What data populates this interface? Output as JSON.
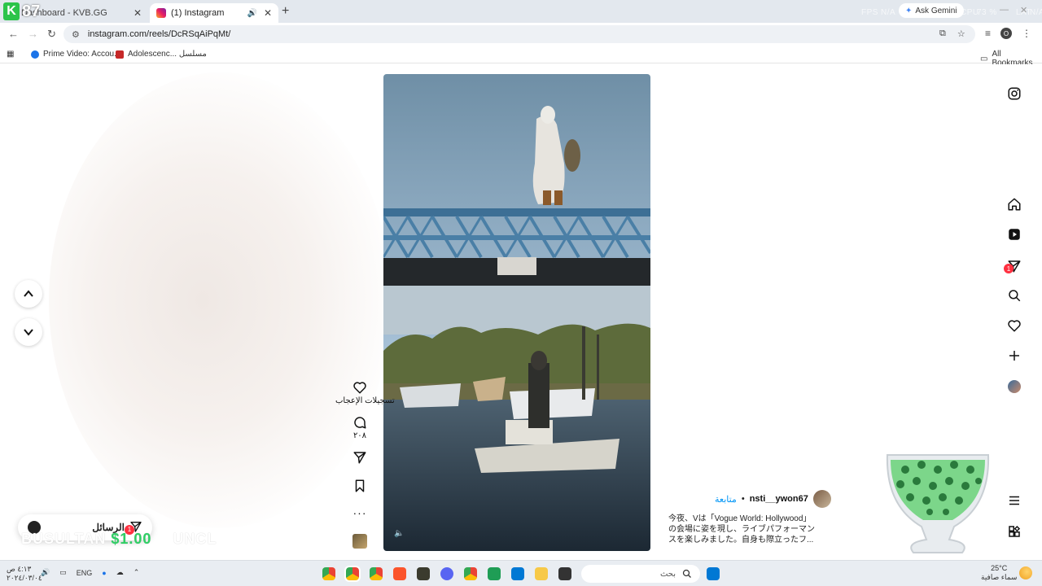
{
  "kvb_overlay": {
    "letter": "K",
    "value": "87"
  },
  "fps_overlay": {
    "fps_label": "FPS",
    "fps_value": "N/A",
    "cpu_label": "CPU",
    "cpu_value": "73 %",
    "lat_label": "LAT",
    "lat_value": "N/A"
  },
  "tabs": [
    {
      "title": "Dashboard - KVB.GG",
      "active": false
    },
    {
      "title": "(1) Instagram",
      "active": true
    }
  ],
  "tab_close_glyph": "✕",
  "new_tab_glyph": "+",
  "ask_gemini": "Ask Gemini",
  "url": "instagram.com/reels/DcRSqAiPqMt/",
  "profile_initial": "O",
  "bookmarks": [
    {
      "label": "Prime Video: Accou...",
      "color": "#1a73e8"
    },
    {
      "label": "Adolescenc... مسلسل",
      "color": "#c62828"
    }
  ],
  "all_bookmarks": "All Bookmarks",
  "reel_actions": {
    "likes_label": "تسجيلات الإعجاب",
    "comments_count": "٢٠٨"
  },
  "author": {
    "username": "nsti__ywon67",
    "follow": "متابعة",
    "separator": "•"
  },
  "caption": "今夜、Vは「Vogue World: Hollywood」の会場に姿を現し、ライブパフォーマンスを楽しみました。自身も際立ったフ...",
  "messages": {
    "label": "الرسائل",
    "badge": "1"
  },
  "notifications_badge": "1",
  "overlay_banner": {
    "name": "BUSULTAN",
    "money": "$1.00",
    "suffix": "UNCL"
  },
  "taskbar": {
    "time": "٤:١٣ ص",
    "date": "٢٠٢٤/٠٣/٠٤",
    "lang": "ENG",
    "search_placeholder": "بحث",
    "temperature": "25°C",
    "weather_desc": "سماء صافية"
  },
  "colors": {
    "accent": "#0095f6",
    "notification": "#ff3040",
    "kvb_green": "#2cc44a"
  }
}
